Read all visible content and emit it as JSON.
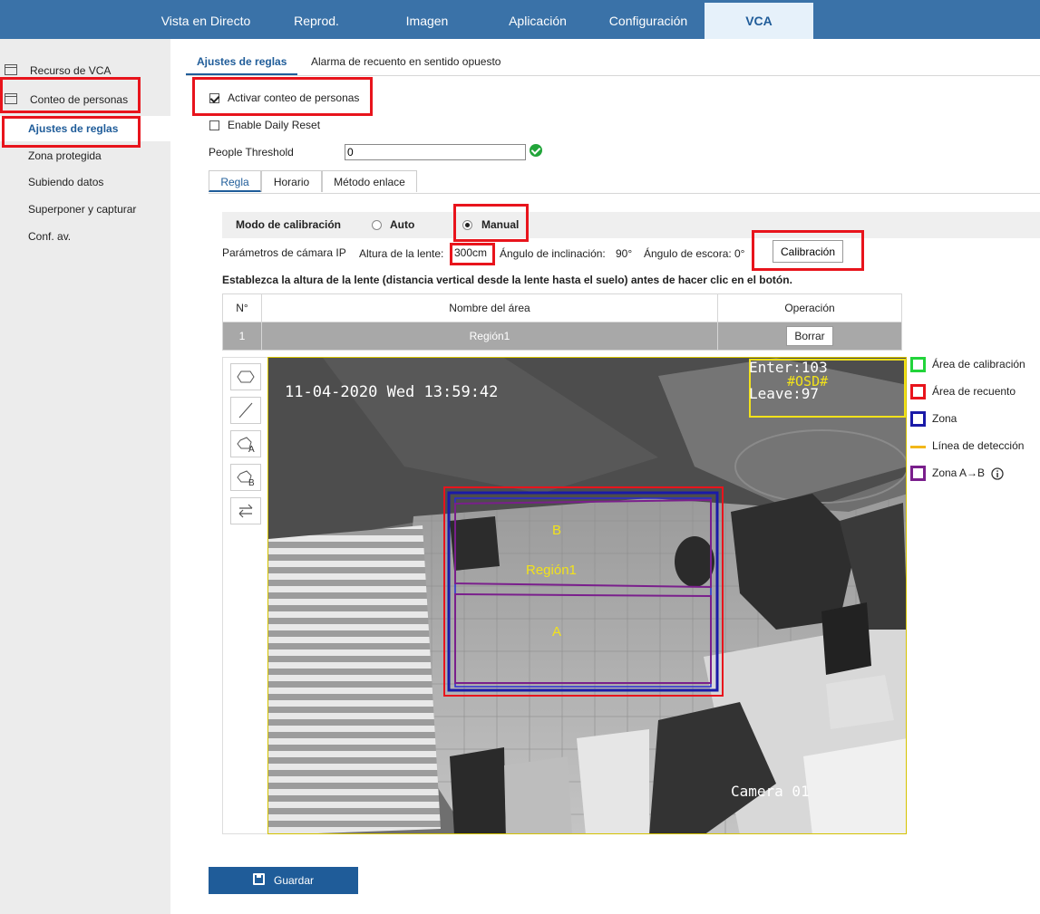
{
  "topnav": {
    "tabs": [
      {
        "label": "Vista en Directo"
      },
      {
        "label": "Reprod."
      },
      {
        "label": "Imagen"
      },
      {
        "label": "Aplicación"
      },
      {
        "label": "Configuración"
      },
      {
        "label": "VCA"
      }
    ],
    "active_index": 5
  },
  "sidebar": {
    "resource": "Recurso de VCA",
    "people_counting": "Conteo de personas",
    "items": [
      {
        "label": "Ajustes de reglas"
      },
      {
        "label": "Zona protegida"
      },
      {
        "label": "Subiendo datos"
      },
      {
        "label": "Superponer y capturar"
      },
      {
        "label": "Conf. av."
      }
    ]
  },
  "content_tabs": [
    "Ajustes de reglas",
    "Alarma de recuento en sentido opuesto"
  ],
  "settings": {
    "enable_counting": "Activar conteo de personas",
    "enable_counting_checked": true,
    "daily_reset": "Enable Daily Reset",
    "daily_reset_checked": false,
    "threshold_label": "People Threshold",
    "threshold_value": "0"
  },
  "sub_tabs": [
    "Regla",
    "Horario",
    "Método enlace"
  ],
  "calibration": {
    "mode_label": "Modo de calibración",
    "auto": "Auto",
    "manual": "Manual",
    "selected": "Manual",
    "camera_params": "Parámetros de cámara IP",
    "height_label": "Altura de la lente:",
    "height_value": "300cm",
    "tilt": "Ángulo de inclinación:",
    "tilt_value": "90°",
    "roll": "Ángulo de escora:",
    "roll_value": "0°",
    "button": "Calibración",
    "instruction": "Establezca la altura de la lente (distancia vertical desde la lente hasta el suelo) antes de hacer clic en el botón."
  },
  "table": {
    "headers": [
      "N°",
      "Nombre del área",
      "Operación"
    ],
    "rows": [
      {
        "n": "1",
        "name": "Región1",
        "op": "Borrar"
      }
    ]
  },
  "video": {
    "timestamp": "11-04-2020 Wed 13:59:42",
    "enter": "Enter:103",
    "leave": "Leave:97",
    "osd": "#OSD#",
    "camera": "Camera 01",
    "zone_b": "B",
    "zone_a": "A",
    "region": "Región1"
  },
  "legend": [
    {
      "label": "Área de calibración",
      "color": "#22d43a"
    },
    {
      "label": "Área de recuento",
      "color": "#e8141c"
    },
    {
      "label": "Zona",
      "color": "#1a1aa8"
    },
    {
      "label": "Línea de detección",
      "color": "#f2b71a"
    },
    {
      "label": "Zona A→B",
      "color": "#7a1f8c"
    }
  ],
  "save_label": "Guardar"
}
